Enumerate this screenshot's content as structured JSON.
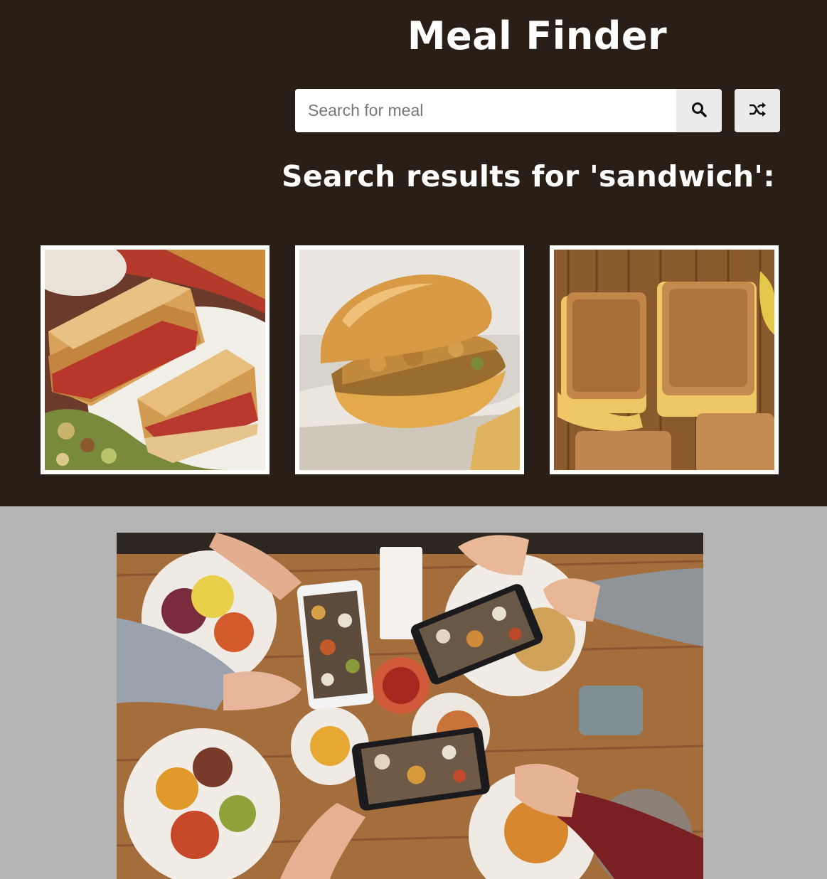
{
  "header": {
    "title": "Meal Finder"
  },
  "search": {
    "placeholder": "Search for meal",
    "value": "",
    "search_icon": "search-icon",
    "random_icon": "shuffle-icon"
  },
  "results": {
    "heading": "Search results for 'sandwich':",
    "meals": [
      {
        "image": "grilled-cheese-tomato-sandwich-photo"
      },
      {
        "image": "crispy-chicken-sandwich-photo"
      },
      {
        "image": "grilled-cheese-mac-sandwich-photo"
      }
    ]
  },
  "hero": {
    "image": "friends-photographing-food-table-photo"
  },
  "colors": {
    "header_bg": "#2a1f17",
    "page_bg": "#b5b5b5",
    "button_bg": "#ebebeb"
  }
}
